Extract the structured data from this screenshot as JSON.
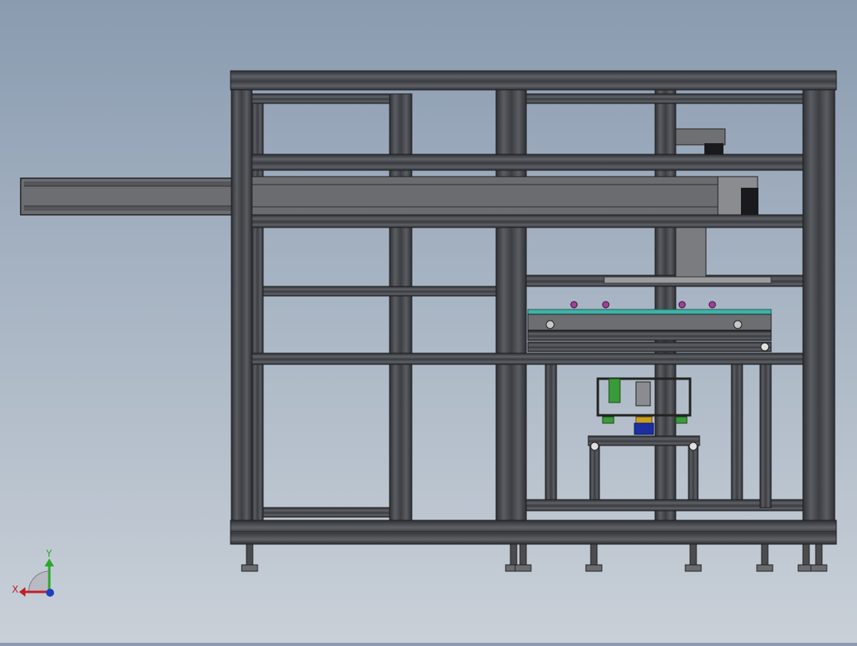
{
  "scene": {
    "background_top": "#8a9bb0",
    "background_bottom": "#c9d0d8",
    "frame_color": "#4a4c50",
    "frame_edge": "#2a2b2e",
    "panel_color": "#6a6c70",
    "plate_color": "#3fb3a8",
    "accent_purple": "#a0409a",
    "accent_green": "#3a9a3a",
    "accent_blue": "#1c2fa0",
    "accent_yellow": "#c8a020"
  },
  "axis_triad": {
    "x_label": "X",
    "y_label": "Y",
    "x_color": "#c0202a",
    "y_color": "#2aa82a",
    "z_color": "#1c3fc0"
  }
}
